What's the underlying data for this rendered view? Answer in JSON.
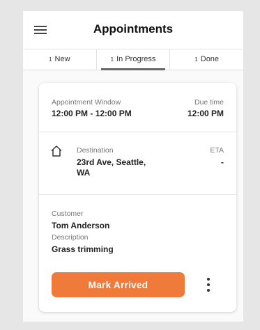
{
  "header": {
    "title": "Appointments",
    "menu_icon": "hamburger-menu-icon"
  },
  "tabs": [
    {
      "count": "1",
      "label": "New",
      "active": false
    },
    {
      "count": "1",
      "label": "In Progress",
      "active": true
    },
    {
      "count": "1",
      "label": "Done",
      "active": false
    }
  ],
  "card": {
    "appointment_window_label": "Appointment Window",
    "appointment_window_value": "12:00 PM - 12:00 PM",
    "due_time_label": "Due time",
    "due_time_value": "12:00 PM",
    "destination_icon": "home-icon",
    "destination_label": "Destination",
    "destination_value": "23rd Ave, Seattle, WA",
    "eta_label": "ETA",
    "eta_value": "-",
    "customer_label": "Customer",
    "customer_value": "Tom Anderson",
    "description_label": "Description",
    "description_value": "Grass trimming",
    "primary_button_label": "Mark Arrived",
    "more_icon": "more-vertical-icon"
  },
  "colors": {
    "accent": "#ef7a3a",
    "background": "#e6e6e6",
    "tab_indicator": "#666666"
  }
}
